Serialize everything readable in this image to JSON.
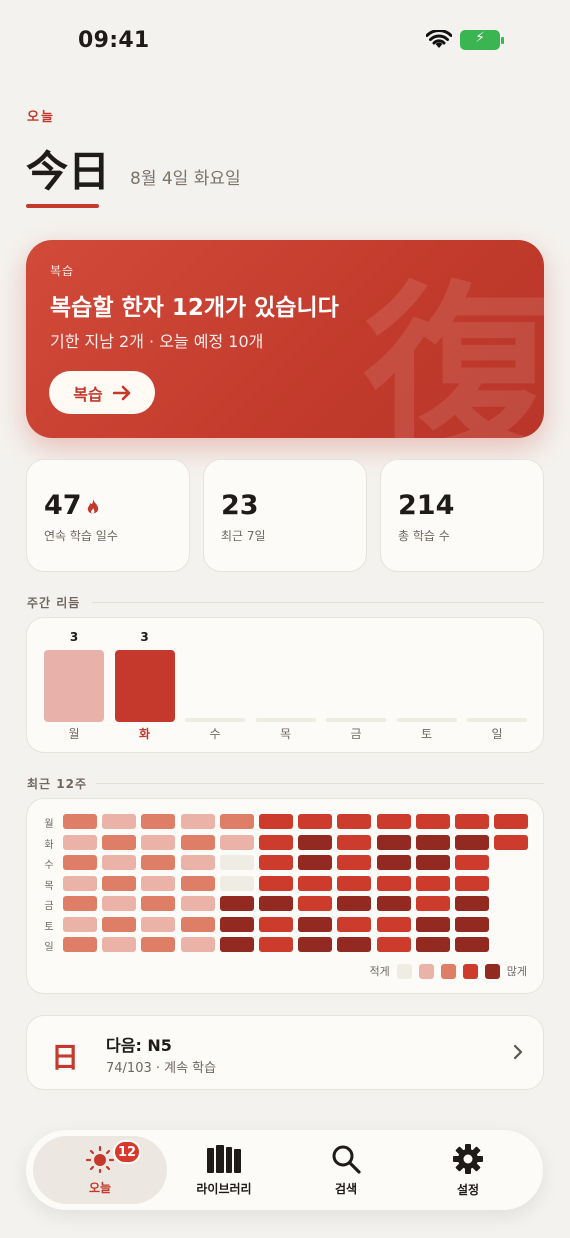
{
  "status_bar": {
    "time": "09:41"
  },
  "header": {
    "eyebrow": "오늘",
    "title_hanja": "今日",
    "date": "8월 4일 화요일"
  },
  "review": {
    "eyebrow": "복습",
    "title": "복습할 한자 12개가 있습니다",
    "subtitle": "기한 지남 2개 · 오늘 예정 10개",
    "button_label": "복습",
    "watermark": "復"
  },
  "stats": [
    {
      "value": "47",
      "label": "연속 학습 일수"
    },
    {
      "value": "23",
      "label": "최근 7일"
    },
    {
      "value": "214",
      "label": "총 학습 수"
    }
  ],
  "weekly": {
    "section_label": "주간 리듬",
    "days": [
      {
        "day": "월",
        "count": "3",
        "value": 3,
        "today": false
      },
      {
        "day": "화",
        "count": "3",
        "value": 3,
        "today": true
      },
      {
        "day": "수",
        "count": "",
        "value": 0,
        "today": false
      },
      {
        "day": "목",
        "count": "",
        "value": 0,
        "today": false
      },
      {
        "day": "금",
        "count": "",
        "value": 0,
        "today": false
      },
      {
        "day": "토",
        "count": "",
        "value": 0,
        "today": false
      },
      {
        "day": "일",
        "count": "",
        "value": 0,
        "today": false
      }
    ]
  },
  "heatmap": {
    "section_label": "최근 12주",
    "row_labels": [
      "월",
      "화",
      "수",
      "목",
      "금",
      "토",
      "일"
    ],
    "levels": [
      [
        2,
        1,
        2,
        1,
        2,
        3,
        3,
        3,
        3,
        3,
        3,
        3
      ],
      [
        1,
        2,
        1,
        2,
        1,
        3,
        4,
        3,
        4,
        4,
        4,
        3
      ],
      [
        2,
        1,
        2,
        1,
        0,
        3,
        4,
        3,
        4,
        4,
        3,
        -1
      ],
      [
        1,
        2,
        1,
        2,
        0,
        3,
        3,
        3,
        3,
        3,
        3,
        -1
      ],
      [
        2,
        1,
        2,
        1,
        4,
        4,
        3,
        4,
        4,
        3,
        4,
        -1
      ],
      [
        1,
        2,
        1,
        2,
        4,
        3,
        4,
        3,
        3,
        4,
        4,
        -1
      ],
      [
        2,
        1,
        2,
        1,
        4,
        3,
        4,
        4,
        3,
        4,
        4,
        -1
      ]
    ],
    "legend_less": "적게",
    "legend_more": "많게",
    "colors": [
      "#efece4",
      "#ebb3a8",
      "#df7e66",
      "#cd3b2d",
      "#922a22"
    ]
  },
  "next": {
    "glyph": "日",
    "title": "다음: N5",
    "subtitle": "74/103 · 계속 학습"
  },
  "tabbar": {
    "tabs": [
      {
        "label": "오늘",
        "icon": "sun-icon",
        "active": true
      },
      {
        "label": "라이브러리",
        "icon": "books-icon",
        "active": false
      },
      {
        "label": "검색",
        "icon": "search-icon",
        "active": false
      },
      {
        "label": "설정",
        "icon": "gear-icon",
        "active": false
      }
    ],
    "badge": "12"
  },
  "accent_color": "#c4392c"
}
